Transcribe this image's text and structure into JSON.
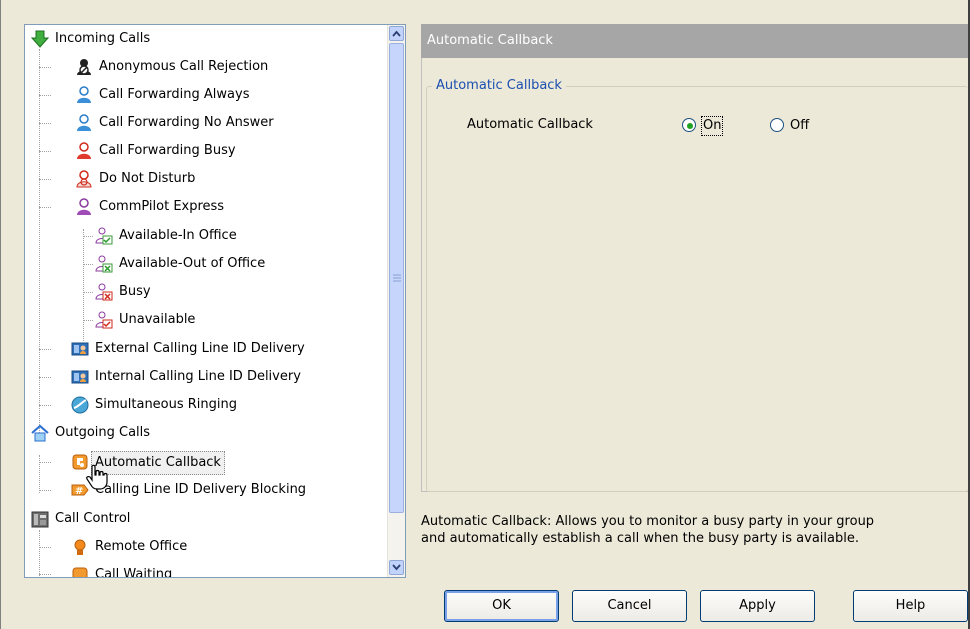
{
  "tree": {
    "items": [
      {
        "label": "Incoming Calls",
        "icon": "incoming-calls-icon"
      },
      {
        "label": "Anonymous Call Rejection",
        "icon": "anonymous-icon"
      },
      {
        "label": "Call Forwarding Always",
        "icon": "person-blue-icon"
      },
      {
        "label": "Call Forwarding No Answer",
        "icon": "person-blue-icon"
      },
      {
        "label": "Call Forwarding Busy",
        "icon": "person-red-icon"
      },
      {
        "label": "Do Not Disturb",
        "icon": "person-red-icon"
      },
      {
        "label": "CommPilot Express",
        "icon": "person-purple-icon"
      },
      {
        "label": "Available-In Office",
        "icon": "person-check-icon"
      },
      {
        "label": "Available-Out of Office",
        "icon": "person-x-green-icon"
      },
      {
        "label": "Busy",
        "icon": "person-x-red-icon"
      },
      {
        "label": "Unavailable",
        "icon": "person-check-red-icon"
      },
      {
        "label": "External Calling Line ID Delivery",
        "icon": "id-card-icon"
      },
      {
        "label": "Internal Calling Line ID Delivery",
        "icon": "id-card-icon"
      },
      {
        "label": "Simultaneous Ringing",
        "icon": "globe-icon"
      },
      {
        "label": "Outgoing Calls",
        "icon": "house-icon"
      },
      {
        "label": "Automatic Callback",
        "icon": "callback-phone-icon"
      },
      {
        "label": "Calling Line ID Delivery Blocking",
        "icon": "hash-icon"
      },
      {
        "label": "Call Control",
        "icon": "desk-phone-icon"
      },
      {
        "label": "Remote Office",
        "icon": "remote-office-icon"
      },
      {
        "label": "Call Waiting",
        "icon": "call-waiting-icon"
      }
    ]
  },
  "panel": {
    "header": "Automatic Callback",
    "group_title": "Automatic Callback",
    "field_label": "Automatic Callback",
    "option_on": "On",
    "option_off": "Off",
    "selected": "On",
    "description_line1": "Automatic Callback: Allows you to monitor a busy party in your group",
    "description_line2": "and automatically establish a call when the busy party is available."
  },
  "buttons": {
    "ok": "OK",
    "cancel": "Cancel",
    "apply": "Apply",
    "help": "Help"
  },
  "colors": {
    "header_bg": "#a6a6a6",
    "group_title": "#1b4fb0",
    "radio_dot": "#21a121",
    "dialog_bg": "#ece9d8"
  }
}
